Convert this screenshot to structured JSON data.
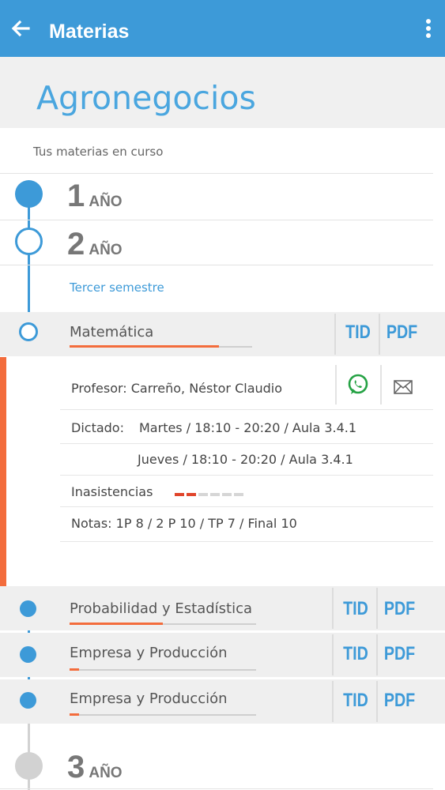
{
  "appbar": {
    "title": "Materias"
  },
  "career": {
    "name": "Agronegocios",
    "subtitle": "Tus materias en curso"
  },
  "years": [
    {
      "num": "1",
      "word": "AÑO"
    },
    {
      "num": "2",
      "word": "AÑO"
    },
    {
      "num": "3",
      "word": "AÑO"
    }
  ],
  "semester": "Tercer semestre",
  "buttons": {
    "tid": "TID",
    "pdf": "PDF"
  },
  "subjects": [
    {
      "name": "Matemática",
      "progress": 0.82
    },
    {
      "name": "Probabilidad y Estadística",
      "progress": 0.5
    },
    {
      "name": "Empresa y Producción",
      "progress": 0.05
    },
    {
      "name": "Empresa y Producción",
      "progress": 0.05
    }
  ],
  "detail": {
    "professor": "Profesor: Carreño, Néstor Claudio",
    "dictado_label": "Dictado:",
    "schedule_1": "Martes / 18:10 - 20:20  / Aula 3.4.1",
    "schedule_2": "Jueves / 18:10 - 20:20  / Aula 3.4.1",
    "absences_label": "Inasistencias",
    "absences": {
      "used": 2,
      "total": 6
    },
    "grades": "Notas:  1P 8 / 2 P 10 / TP 7 / Final 10"
  },
  "colors": {
    "primary": "#3d9ad8",
    "accent": "#f36c3c",
    "whatsapp": "#25a244"
  },
  "icons": [
    "arrow-back-icon",
    "more-vert-icon",
    "whatsapp-icon",
    "mail-icon"
  ]
}
